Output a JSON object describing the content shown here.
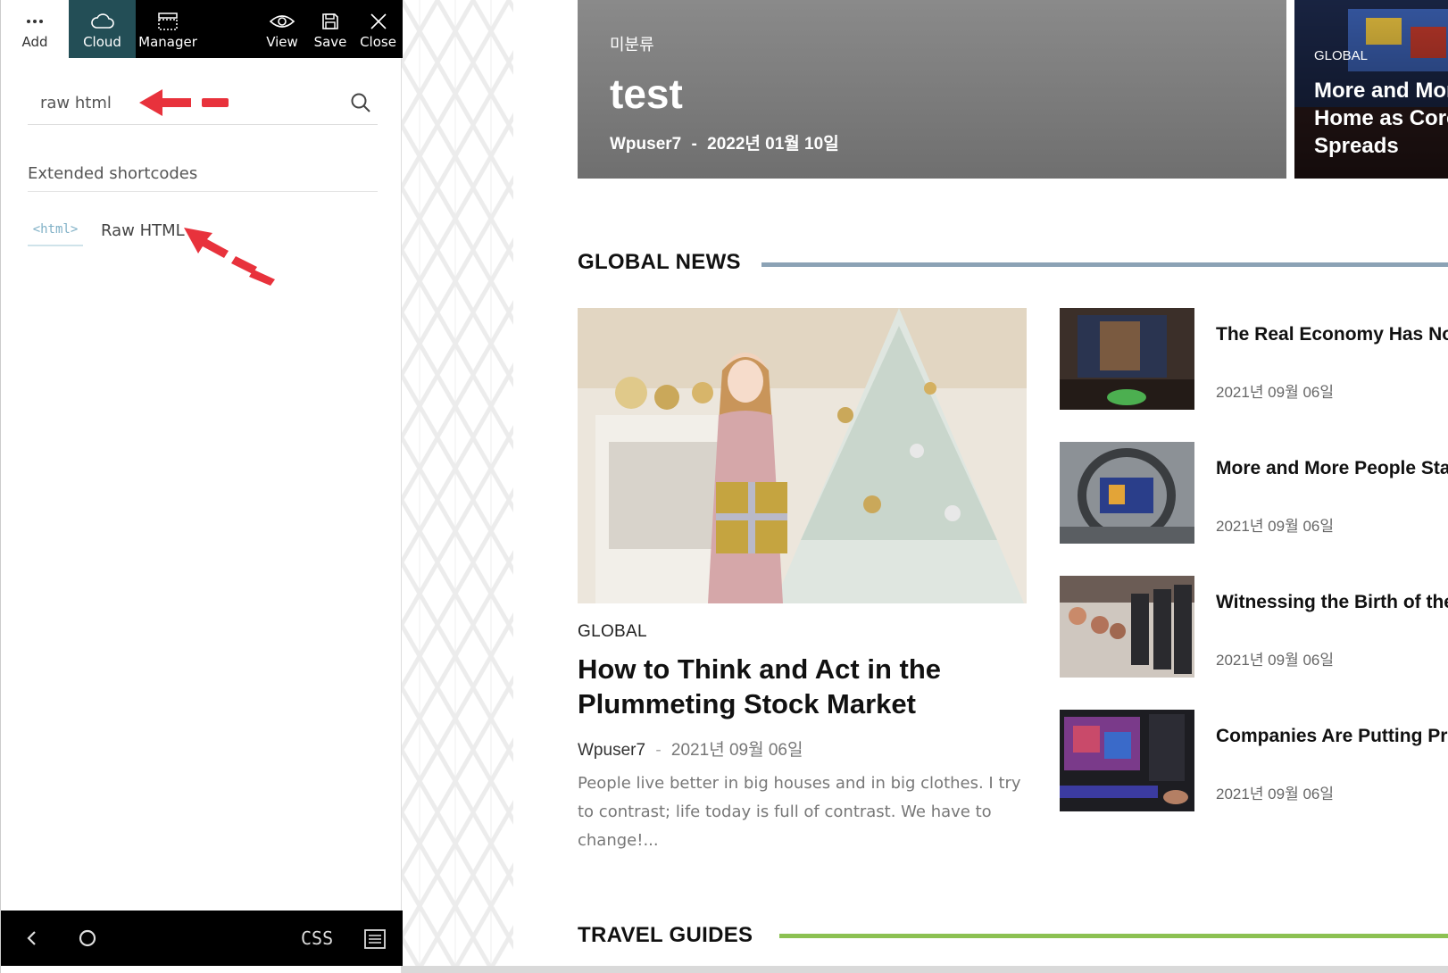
{
  "toolbar": {
    "add_label": "Add",
    "cloud_label": "Cloud",
    "manager_label": "Manager",
    "view_label": "View",
    "save_label": "Save",
    "close_label": "Close"
  },
  "search": {
    "value": "raw html",
    "icon": "search-icon"
  },
  "panel": {
    "section_label": "Extended shortcodes",
    "items": [
      {
        "icon_text": "<html>",
        "label": "Raw HTML"
      }
    ]
  },
  "bottom_bar": {
    "css_label": "CSS",
    "icons": [
      "chevron-left-icon",
      "circle-icon",
      "css-icon",
      "list-icon"
    ]
  },
  "site": {
    "hero": {
      "category": "미분류",
      "title": "test",
      "author": "Wpuser7",
      "separator": "-",
      "date": "2022년 01월 10일"
    },
    "hero2": {
      "category": "GLOBAL",
      "title": "More and More People Stay Home as Coronavirus Spreads"
    },
    "global_news": {
      "heading": "GLOBAL NEWS",
      "featured": {
        "category": "GLOBAL",
        "title": "How to Think and Act in the Plummeting Stock Market",
        "author": "Wpuser7",
        "separator": "-",
        "date": "2021년 09월 06일",
        "excerpt": "People live better in big houses and in big clothes. I try to contrast; life today is full of contrast. We have to change!..."
      },
      "side_items": [
        {
          "title": "The Real Economy Has Not Been Tested by a Pandemic",
          "date": "2021년 09월 06일"
        },
        {
          "title": "More and More People Stay Home as Coronavirus Spreads",
          "date": "2021년 09월 06일"
        },
        {
          "title": "Witnessing the Birth of the New Coronavirus Economy",
          "date": "2021년 09월 06일"
        },
        {
          "title": "Companies Are Putting Profits Ahead of Public Health",
          "date": "2021년 09월 06일"
        }
      ]
    },
    "travel_guides": {
      "heading": "TRAVEL GUIDES"
    }
  },
  "colors": {
    "toolbar_bg": "#000000",
    "cloud_active_bg": "#234e56",
    "global_news_line": "#8ba2b5",
    "travel_guides_line": "#8cc152",
    "annotation_arrow": "#e8323c"
  }
}
